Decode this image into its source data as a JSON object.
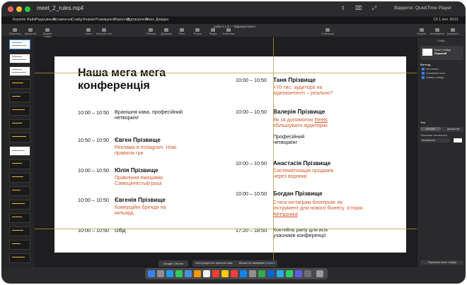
{
  "qt": {
    "filename": "meet_2_rules.mp4",
    "open_with": "Відкрити: QuickTime Player",
    "controls": "⇪ ⌧ ⤢"
  },
  "menubar": {
    "items": [
      "Keynote",
      "Файл",
      "Редагування",
      "Вставлення",
      "Слайд",
      "Формат",
      "Розміщення",
      "Перегляд",
      "Відтворення",
      "Вікно",
      "Довідка"
    ],
    "clock": "Сб 1 лют. 20:01"
  },
  "toolbar": {
    "doc_title": "рабр-0.1.9 — Відредаговано",
    "items": [
      "Перегляд",
      "Масштаб",
      "Додати слайд",
      "",
      "Грати",
      "Keynote Live",
      "",
      "Таблиця",
      "Діаграма",
      "Текст",
      "Фігура",
      "Медіа",
      "Коментар",
      "",
      "Співпраця",
      "",
      "Формат",
      "Анімування",
      "Документ"
    ]
  },
  "slide": {
    "title": "Наша мега мега конференція",
    "left": [
      {
        "time": "10:00 – 10:50",
        "name": "",
        "plain": "Вранішня кава, професійний нетворкінг",
        "topic": ""
      },
      {
        "time": "10:50 – 10:50",
        "name": "Євген Прізвище",
        "plain": "",
        "topic": "Реклама в Instagram. Нові правила гри"
      },
      {
        "time": "10:00 – 10:50",
        "name": "Юлія Прізвище",
        "plain": "",
        "topic": "Правління емоціями. Самоцінність&гроші"
      },
      {
        "time": "10:00 – 10:50",
        "name": "Євгенія Прізвище",
        "plain": "",
        "topic": "Комерційні бренди на мільярд"
      },
      {
        "time": "10:00 – 10:50",
        "name": "",
        "plain": "Обід",
        "topic": ""
      }
    ],
    "right": [
      {
        "time": "10:00 – 10:50",
        "name": "Таня Прізвище",
        "plain": "",
        "topic": "+70 тис. аудиторії на відеоконтенті – реально?"
      },
      {
        "time": "10:00 – 10:50",
        "name": "Валерія Прізвище",
        "plain": "Професійний нетворкінг",
        "topic_a": "Як за допомогою ",
        "topic_link": "Reels",
        "topic_b": " збільшувати аудиторію"
      },
      {
        "time": "10:00 – 10:50",
        "name": "Анастасія Прізвище",
        "plain": "",
        "topic": "Систематизація продажів через воронки"
      },
      {
        "time": "10:00 – 10:50",
        "name": "Богдан Прізвище",
        "plain": "",
        "topic_a": "Стати інстаграм блогером: як інструмент для нового бізнесу. Історія ",
        "topic_link": "Айтішника",
        "topic_b": ""
      },
      {
        "time": "17:20 – 18:50",
        "name": "",
        "plain": "Коктейль party для всіх учасників конференції",
        "topic": ""
      }
    ]
  },
  "inspector": {
    "tab": "Слайд",
    "layout_label": "Макет слайда",
    "layout_name": "Порожній",
    "appearance": "Вигляд",
    "check_title": "Заголовок",
    "check_body": "Основний текст",
    "check_number": "Номер слайда",
    "background": "Тло",
    "bg_seg_a": "Фонове",
    "bg_seg_b": "Динамічне",
    "fill_label": "Початкове заповнення",
    "fill_value": "Заповнення",
    "edit_layout": "Редагувати макет слайда"
  },
  "share": {
    "app": "Google Chrome",
    "message": "meet.google.com транслює ваш",
    "hide": "Більше не показувати",
    "stop": "Сховати"
  },
  "colors": {
    "accent": "#d0572a",
    "selection": "#3b82f6",
    "guide": "#b79b3a"
  }
}
